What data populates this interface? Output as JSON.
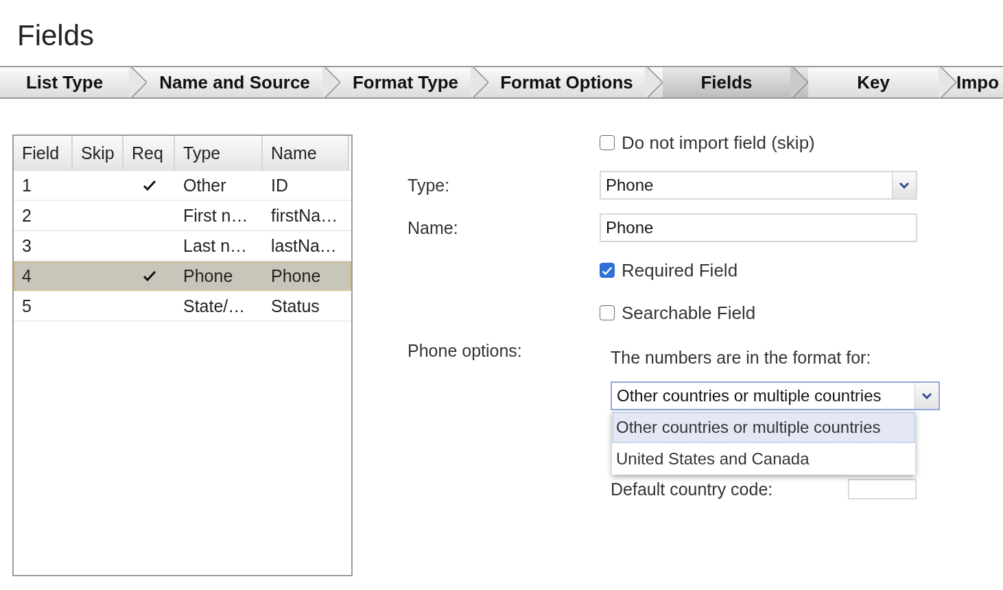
{
  "title": "Fields",
  "steps": [
    {
      "label": "List Type",
      "selected": false
    },
    {
      "label": "Name and Source",
      "selected": false
    },
    {
      "label": "Format Type",
      "selected": false
    },
    {
      "label": "Format Options",
      "selected": false
    },
    {
      "label": "Fields",
      "selected": true
    },
    {
      "label": "Key",
      "selected": false
    },
    {
      "label": "Impo",
      "selected": false
    }
  ],
  "table": {
    "columns": [
      "Field",
      "Skip",
      "Req",
      "Type",
      "Name"
    ],
    "rows": [
      {
        "field": "1",
        "required": true,
        "type": "Other",
        "name": "ID",
        "selected": false
      },
      {
        "field": "2",
        "required": false,
        "type": "First n…",
        "name": "firstNa…",
        "selected": false
      },
      {
        "field": "3",
        "required": false,
        "type": "Last n…",
        "name": "lastNa…",
        "selected": false
      },
      {
        "field": "4",
        "required": true,
        "type": "Phone",
        "name": "Phone",
        "selected": true
      },
      {
        "field": "5",
        "required": false,
        "type": "State/…",
        "name": "Status",
        "selected": false
      }
    ]
  },
  "form": {
    "skip_checkbox": {
      "label": "Do not import field (skip)",
      "checked": false
    },
    "type": {
      "label": "Type:",
      "value": "Phone"
    },
    "name": {
      "label": "Name:",
      "value": "Phone"
    },
    "required_checkbox": {
      "label": "Required Field",
      "checked": true
    },
    "searchable_checkbox": {
      "label": "Searchable Field",
      "checked": false
    },
    "phone_options": {
      "label": "Phone options:",
      "prompt": "The numbers are in the format for:",
      "format_select": {
        "value": "Other countries or multiple countries",
        "expanded": true,
        "options": [
          {
            "label": "Other countries or multiple countries",
            "selected": true
          },
          {
            "label": "United States and Canada",
            "selected": false
          }
        ]
      },
      "default_country_code": {
        "label": "Default country code:"
      }
    }
  }
}
